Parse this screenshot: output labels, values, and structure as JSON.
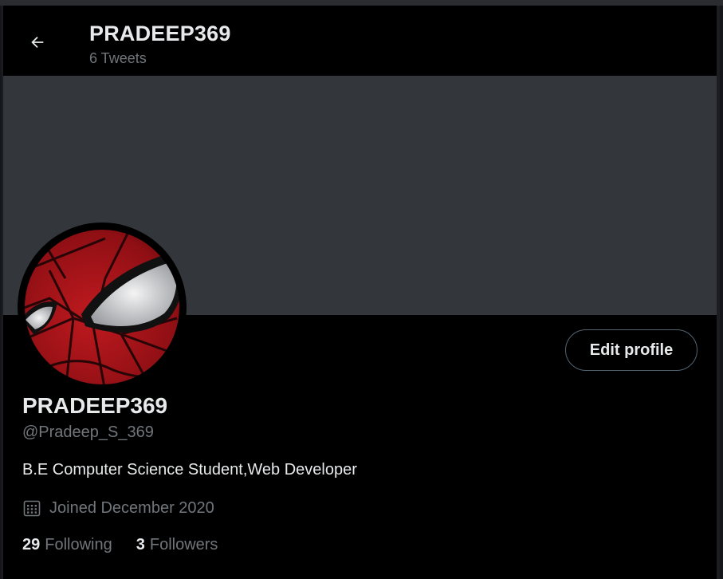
{
  "header": {
    "title": "PRADEEP369",
    "tweet_count": "6 Tweets",
    "back_icon": "arrow-left-icon"
  },
  "profile": {
    "display_name": "PRADEEP369",
    "handle": "@Pradeep_S_369",
    "bio": "B.E Computer Science Student,Web Developer",
    "joined": "Joined December 2020",
    "calendar_icon": "calendar-icon",
    "edit_button_label": "Edit profile",
    "avatar_description": "spider-man-mask-avatar"
  },
  "stats": {
    "following_count": "29",
    "following_label": "Following",
    "followers_count": "3",
    "followers_label": "Followers"
  },
  "colors": {
    "background": "#000000",
    "banner": "#33373b",
    "primary_text": "#e7e9ea",
    "secondary_text": "#71767b",
    "button_border": "#536471"
  }
}
